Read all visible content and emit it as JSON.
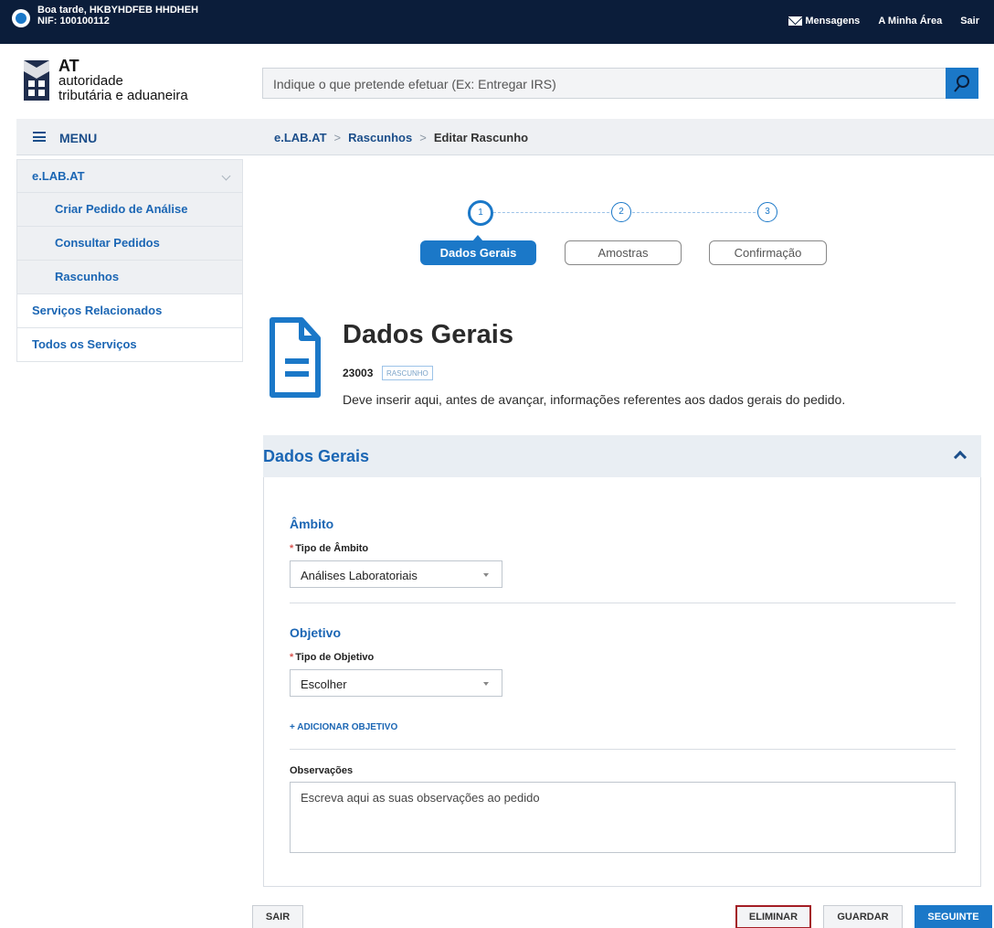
{
  "topbar": {
    "greeting": "Boa tarde, HKBYHDFEB HHDHEH",
    "nif": "NIF: 100100112",
    "messages": "Mensagens",
    "my_area": "A Minha Área",
    "exit": "Sair"
  },
  "logo": {
    "line1": "AT",
    "line2": "autoridade",
    "line3": "tributária e aduaneira"
  },
  "search": {
    "placeholder": "Indique o que pretende efetuar (Ex: Entregar IRS)"
  },
  "menu": {
    "label": "MENU",
    "items": [
      {
        "label": "e.LAB.AT",
        "kind": "group"
      },
      {
        "label": "Criar Pedido de Análise",
        "kind": "sub"
      },
      {
        "label": "Consultar Pedidos",
        "kind": "sub"
      },
      {
        "label": "Rascunhos",
        "kind": "sub"
      },
      {
        "label": "Serviços Relacionados",
        "kind": "item"
      },
      {
        "label": "Todos os Serviços",
        "kind": "item"
      }
    ]
  },
  "breadcrumb": {
    "items": [
      "e.LAB.AT",
      "Rascunhos"
    ],
    "current": "Editar Rascunho",
    "separator": ">"
  },
  "steps": [
    {
      "number": "1",
      "label": "Dados Gerais",
      "active": true
    },
    {
      "number": "2",
      "label": "Amostras",
      "active": false
    },
    {
      "number": "3",
      "label": "Confirmação",
      "active": false
    }
  ],
  "page": {
    "title": "Dados Gerais",
    "reference": "23003",
    "status_badge": "RASCUNHO",
    "description": "Deve inserir aqui, antes de avançar, informações referentes aos dados gerais do pedido."
  },
  "panel": {
    "title": "Dados Gerais",
    "ambito": {
      "section_title": "Âmbito",
      "field_label": "Tipo de Âmbito",
      "value": "Análises Laboratoriais"
    },
    "objetivo": {
      "section_title": "Objetivo",
      "field_label": "Tipo de Objetivo",
      "value": "Escolher",
      "add_link": "+ ADICIONAR OBJETIVO"
    },
    "observacoes": {
      "label": "Observações",
      "placeholder": "Escreva aqui as suas observações ao pedido"
    }
  },
  "footer": {
    "exit": "SAIR",
    "delete": "ELIMINAR",
    "save": "GUARDAR",
    "next": "SEGUINTE"
  },
  "colors": {
    "topbar": "#0b1d3a",
    "primary": "#1b78c8",
    "link": "#1b66b4",
    "danger_outline": "#a31d24"
  }
}
